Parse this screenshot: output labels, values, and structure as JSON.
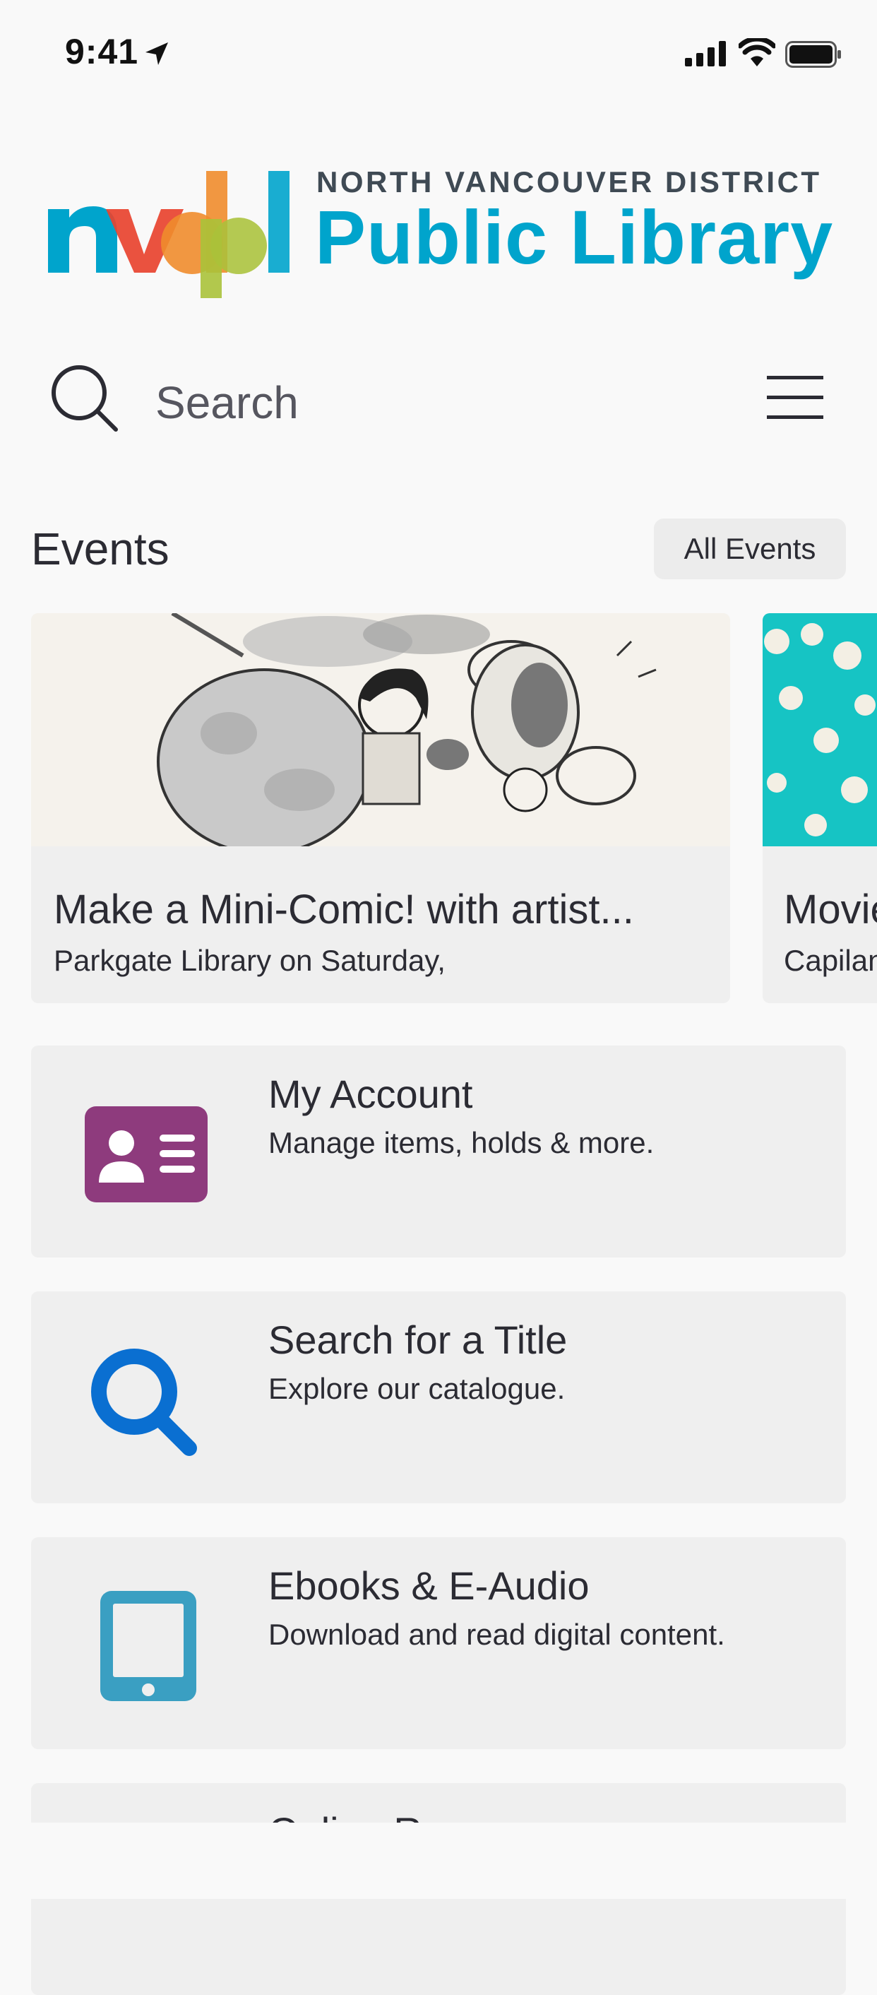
{
  "status_bar": {
    "time": "9:41"
  },
  "logo": {
    "mark": "nvdpl",
    "line1": "NORTH VANCOUVER DISTRICT",
    "line2": "Public Library"
  },
  "search": {
    "placeholder": "Search"
  },
  "events": {
    "title": "Events",
    "all_button": "All Events",
    "items": [
      {
        "title": "Make a Mini-Comic! with artist...",
        "subtitle": "Parkgate Library on Saturday,"
      },
      {
        "title": "Movie",
        "subtitle": "Capilano"
      }
    ]
  },
  "menu": [
    {
      "title": "My Account",
      "subtitle": "Manage items, holds & more.",
      "icon": "account-card-icon",
      "color": "#8e3b7d"
    },
    {
      "title": "Search for a Title",
      "subtitle": "Explore our catalogue.",
      "icon": "magnifier-icon",
      "color": "#0a6fd1"
    },
    {
      "title": "Ebooks & E-Audio",
      "subtitle": "Download and read digital content.",
      "icon": "tablet-icon",
      "color": "#3a9fc2"
    },
    {
      "title": "Online Resources",
      "subtitle": "",
      "icon": "",
      "color": ""
    }
  ],
  "colors": {
    "brand_blue": "#00a4cc",
    "background": "#f9f9f9",
    "card": "#efefef"
  }
}
